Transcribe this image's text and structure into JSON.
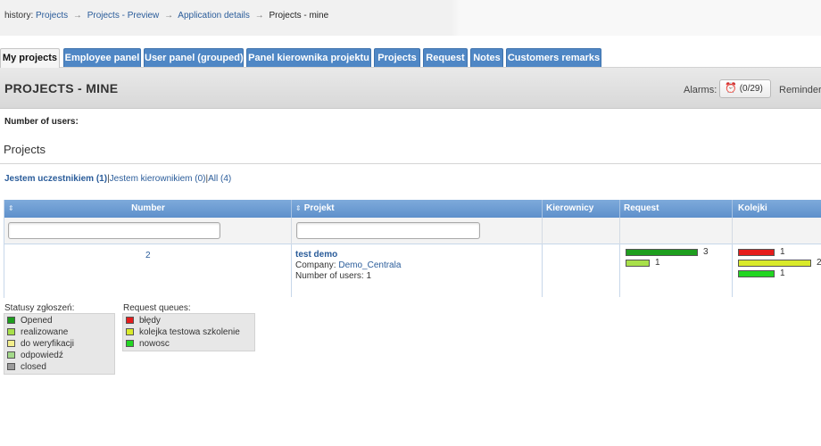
{
  "history": {
    "label": "history:",
    "links": [
      "Projects",
      "Projects - Preview",
      "Application details"
    ],
    "current": "Projects - mine"
  },
  "tabs": [
    {
      "label": "My projects",
      "active": true
    },
    {
      "label": "Employee panel",
      "active": false
    },
    {
      "label": "User panel (grouped)",
      "active": false
    },
    {
      "label": "Panel kierownika projektu",
      "active": false
    },
    {
      "label": "Projects",
      "active": false
    },
    {
      "label": "Request",
      "active": false
    },
    {
      "label": "Notes",
      "active": false
    },
    {
      "label": "Customers remarks",
      "active": false
    }
  ],
  "page": {
    "title": "PROJECTS - MINE",
    "alarms_label": "Alarms:",
    "alarms_value": "(0/29)",
    "reminders_label": "Reminders",
    "users_count_label": "Number of users:",
    "section_title": "Projects"
  },
  "filters": {
    "participant": "Jestem uczestnikiem (1)",
    "manager": "Jestem kierownikiem (0)",
    "all": "All (4)",
    "separator": "|"
  },
  "grid": {
    "columns": [
      "Number",
      "Projekt",
      "Kierownicy",
      "Request",
      "Kolejki"
    ],
    "rows": [
      {
        "number": "2",
        "project_name": "test demo",
        "company_label": "Company:",
        "company_value": "Demo_Centrala",
        "users_label": "Number of users:",
        "users_value": "1",
        "requests": [
          {
            "status": "Opened",
            "value": 3,
            "color": "#1e9e1e"
          },
          {
            "status": "realizowane",
            "value": 1,
            "color": "#a8e04a"
          }
        ],
        "queues": [
          {
            "queue": "błędy",
            "value": 1,
            "color": "#e51c1c"
          },
          {
            "queue": "kolejka testowa szkolenie",
            "value": 2,
            "color": "#d9ea2a"
          },
          {
            "queue": "nowosc",
            "value": 1,
            "color": "#22d622"
          }
        ]
      }
    ]
  },
  "legends": {
    "statuses": {
      "title": "Statusy zgłoszeń:",
      "items": [
        {
          "label": "Opened",
          "color": "#1e9e1e"
        },
        {
          "label": "realizowane",
          "color": "#a8e04a"
        },
        {
          "label": "do weryfikacji",
          "color": "#f3ee8c"
        },
        {
          "label": "odpowiedź",
          "color": "#a3d98a"
        },
        {
          "label": "closed",
          "color": "#9c9c9c"
        }
      ]
    },
    "queues": {
      "title": "Request queues:",
      "items": [
        {
          "label": "błędy",
          "color": "#e51c1c"
        },
        {
          "label": "kolejka testowa szkolenie",
          "color": "#d9ea2a"
        },
        {
          "label": "nowosc",
          "color": "#22d622"
        }
      ]
    }
  }
}
